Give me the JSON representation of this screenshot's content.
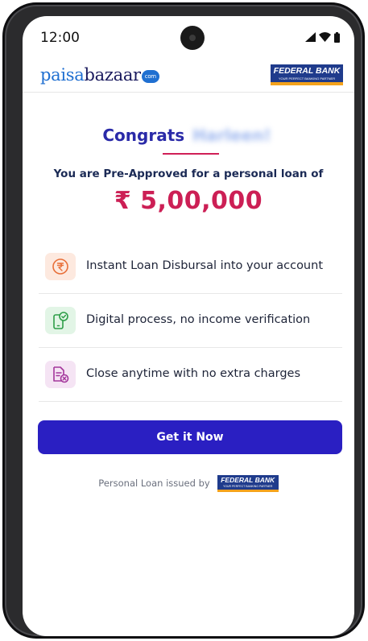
{
  "status_bar": {
    "time": "12:00",
    "icons": [
      "signal-icon",
      "wifi-icon",
      "battery-icon"
    ]
  },
  "header": {
    "brand_part1": "paisa",
    "brand_part2": "bazaar",
    "brand_badge": "com",
    "partner_logo": {
      "name": "FEDERAL BANK",
      "tagline": "YOUR PERFECT BANKING PARTNER"
    }
  },
  "offer": {
    "congrats": "Congrats",
    "recipient_name": "Harleen!",
    "subtitle": "You are Pre-Approved for a personal loan of",
    "amount": "₹ 5,00,000"
  },
  "features": [
    {
      "text": "Instant Loan Disbursal into your account",
      "icon": "rupee-icon",
      "icon_bg": "#fde9df",
      "icon_color": "#e8703a"
    },
    {
      "text": "Digital process, no income verification",
      "icon": "phone-check-icon",
      "icon_bg": "#e2f5e6",
      "icon_color": "#2e9e48"
    },
    {
      "text": "Close anytime with no extra charges",
      "icon": "document-close-icon",
      "icon_bg": "#f5e4f4",
      "icon_color": "#a3369b"
    }
  ],
  "cta": {
    "label": "Get it Now"
  },
  "footer": {
    "issued_by": "Personal Loan issued by",
    "bank_logo": {
      "name": "FEDERAL BANK",
      "tagline": "YOUR PERFECT BANKING PARTNER"
    }
  },
  "colors": {
    "primary": "#2a1fc2",
    "accent": "#cc1f55",
    "heading": "#2a2aa8",
    "bank_blue": "#1f3b8c",
    "bank_orange": "#f4a21c"
  }
}
